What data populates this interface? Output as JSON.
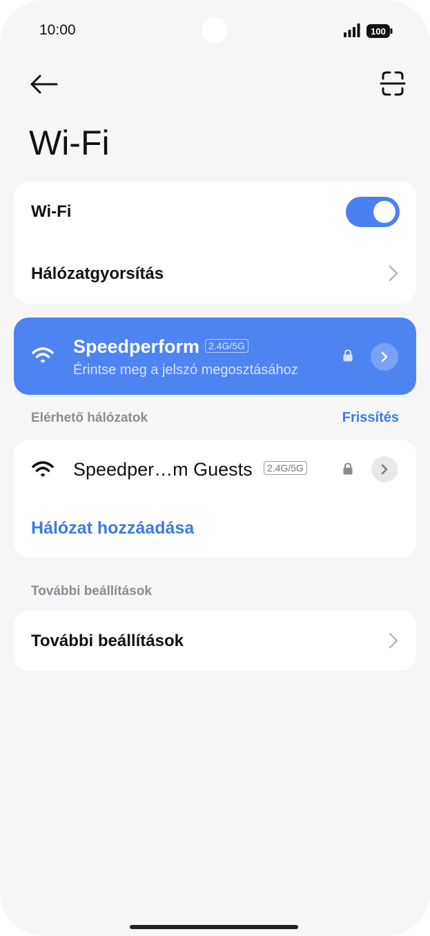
{
  "status_bar": {
    "time": "10:00",
    "battery": "100",
    "icons": [
      "signal-icon",
      "battery-icon"
    ]
  },
  "header": {
    "title": "Wi-Fi",
    "icons": [
      "back-arrow-icon",
      "scan-qr-icon"
    ]
  },
  "toggle_card": {
    "wifi_label": "Wi-Fi",
    "wifi_enabled": true,
    "accelerate_label": "Hálózatgyorsítás"
  },
  "connected_network": {
    "name": "Speedperform",
    "band": "2.4G/5G",
    "subtitle": "Érintse meg a jelszó megosztásához",
    "secured": true
  },
  "available": {
    "section_label": "Elérhető hálózatok",
    "refresh_label": "Frissítés",
    "networks": [
      {
        "name": "Speedper…m Guests",
        "band": "2.4G/5G",
        "secured": true
      }
    ],
    "add_network_label": "Hálózat hozzáadása"
  },
  "more": {
    "section_label": "További beállítások",
    "item_label": "További beállítások"
  },
  "colors": {
    "accent": "#4a80f0",
    "connected_bg": "#4e84f2",
    "link": "#3f78e8",
    "background": "#f6f6f6"
  }
}
